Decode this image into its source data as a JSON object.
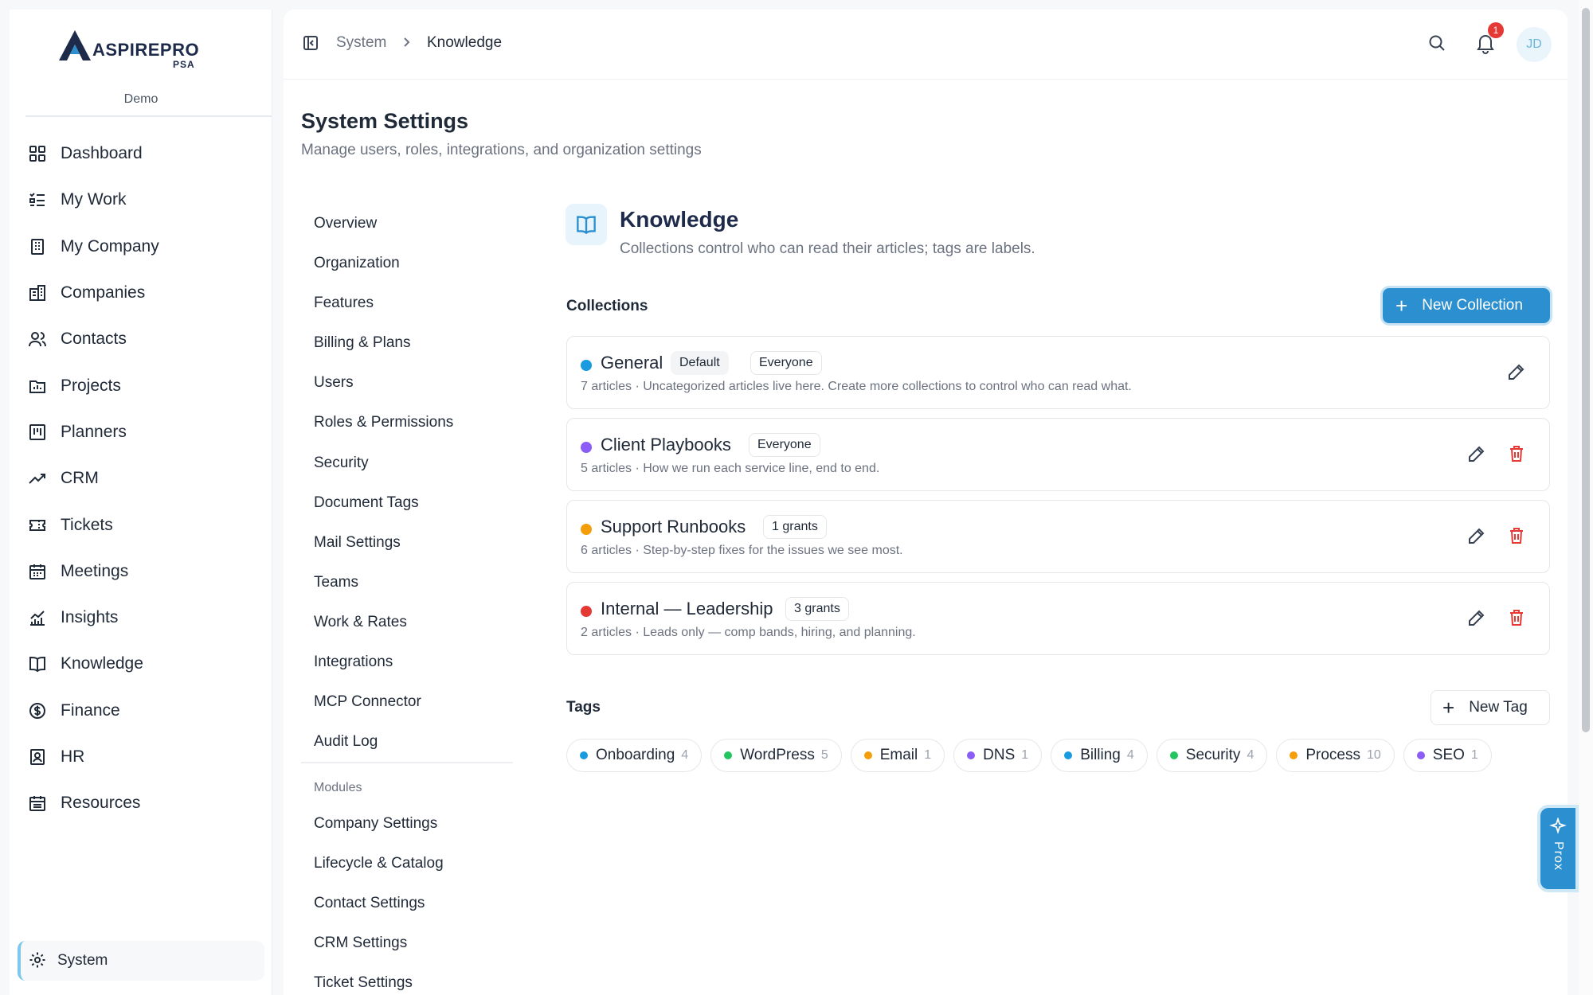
{
  "brand": {
    "name": "ASPIREPRO",
    "sub": "PSA",
    "org": "Demo"
  },
  "sidebar": {
    "items": [
      {
        "label": "Dashboard",
        "icon": "dashboard-icon"
      },
      {
        "label": "My Work",
        "icon": "checklist-icon"
      },
      {
        "label": "My Company",
        "icon": "building-icon"
      },
      {
        "label": "Companies",
        "icon": "buildings-icon"
      },
      {
        "label": "Contacts",
        "icon": "users-icon"
      },
      {
        "label": "Projects",
        "icon": "folder-icon"
      },
      {
        "label": "Planners",
        "icon": "kanban-icon"
      },
      {
        "label": "CRM",
        "icon": "trend-icon"
      },
      {
        "label": "Tickets",
        "icon": "ticket-icon"
      },
      {
        "label": "Meetings",
        "icon": "calendar-icon"
      },
      {
        "label": "Insights",
        "icon": "chart-icon"
      },
      {
        "label": "Knowledge",
        "icon": "book-icon"
      },
      {
        "label": "Finance",
        "icon": "dollar-icon"
      },
      {
        "label": "HR",
        "icon": "id-badge-icon"
      },
      {
        "label": "Resources",
        "icon": "calendar-grid-icon"
      }
    ],
    "bottom": {
      "label": "System",
      "icon": "gear-icon"
    }
  },
  "topbar": {
    "breadcrumb": [
      "System",
      "Knowledge"
    ],
    "notification_count": "1",
    "avatar_initials": "JD"
  },
  "page": {
    "title": "System Settings",
    "subtitle": "Manage users, roles, integrations, and organization settings"
  },
  "settings_nav": [
    "Overview",
    "Organization",
    "Features",
    "Billing & Plans",
    "Users",
    "Roles & Permissions",
    "Security",
    "Document Tags",
    "Mail Settings",
    "Teams",
    "Work & Rates",
    "Integrations",
    "MCP Connector",
    "Audit Log"
  ],
  "modules": {
    "label": "Modules",
    "items": [
      "Company Settings",
      "Lifecycle & Catalog",
      "Contact Settings",
      "CRM Settings",
      "Ticket Settings"
    ]
  },
  "knowledge": {
    "title": "Knowledge",
    "subtitle": "Collections control who can read their articles; tags are labels.",
    "collections_label": "Collections",
    "new_collection_label": "New Collection",
    "collections": [
      {
        "name": "General",
        "color": "#1a9be0",
        "badges": [
          "Default",
          "Everyone"
        ],
        "meta": "7 articles · Uncategorized articles live here. Create more collections to control who can read what."
      },
      {
        "name": "Client Playbooks",
        "color": "#8b5cf6",
        "badges": [
          "Everyone"
        ],
        "meta": "5 articles · How we run each service line, end to end."
      },
      {
        "name": "Support Runbooks",
        "color": "#f59e0b",
        "badges": [
          "1 grants"
        ],
        "meta": "6 articles · Step-by-step fixes for the issues we see most."
      },
      {
        "name": "Internal — Leadership",
        "color": "#e53935",
        "badges": [
          "3 grants"
        ],
        "meta": "2 articles · Leads only — comp bands, hiring, and planning."
      }
    ],
    "tags_label": "Tags",
    "new_tag_label": "New Tag",
    "tags": [
      {
        "name": "Onboarding",
        "count": "4",
        "color": "#1a9be0"
      },
      {
        "name": "WordPress",
        "count": "5",
        "color": "#22c55e"
      },
      {
        "name": "Email",
        "count": "1",
        "color": "#f59e0b"
      },
      {
        "name": "DNS",
        "count": "1",
        "color": "#8b5cf6"
      },
      {
        "name": "Billing",
        "count": "4",
        "color": "#1a9be0"
      },
      {
        "name": "Security",
        "count": "4",
        "color": "#22c55e"
      },
      {
        "name": "Process",
        "count": "10",
        "color": "#f59e0b"
      },
      {
        "name": "SEO",
        "count": "1",
        "color": "#8b5cf6"
      }
    ]
  },
  "assistant": {
    "label": "Prox"
  },
  "colors": {
    "accent": "#2b8fd0",
    "danger": "#e53935"
  }
}
